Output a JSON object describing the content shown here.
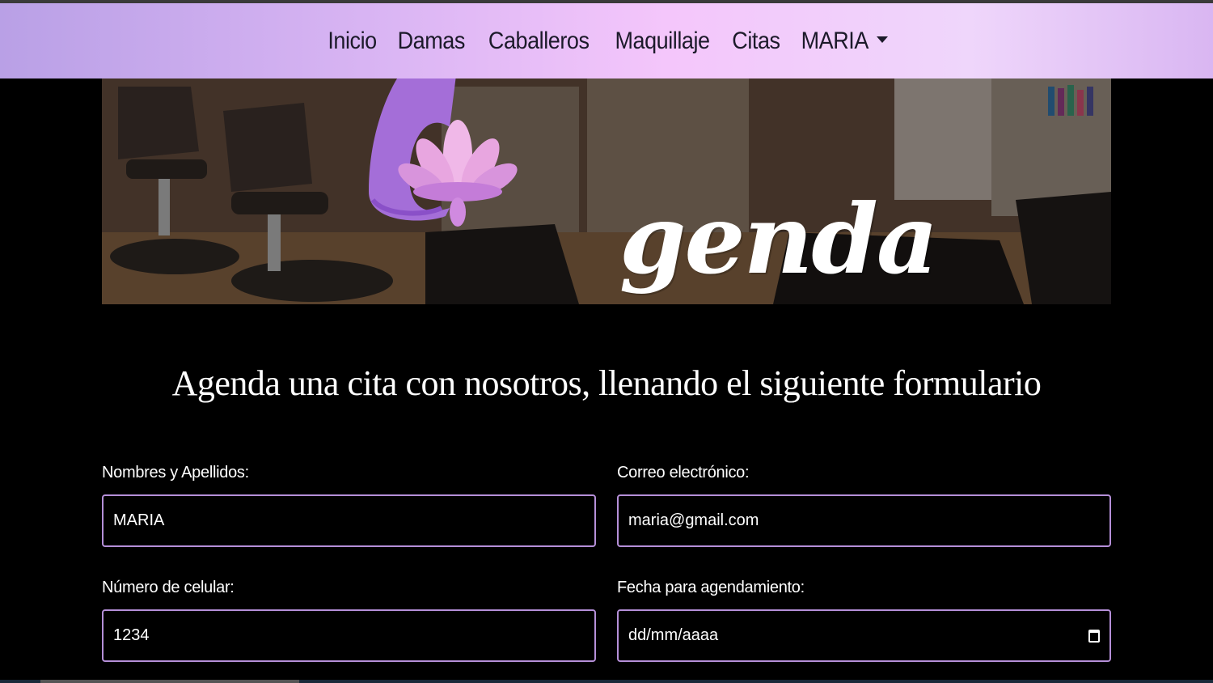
{
  "nav": {
    "items": [
      "Inicio",
      "Damas",
      "Caballeros",
      "Maquillaje",
      "Citas"
    ],
    "user_menu": "MARIA"
  },
  "banner": {
    "logo_text": "genda",
    "logo_initial": "A"
  },
  "heading": "Agenda una cita con nosotros, llenando el siguiente formulario",
  "form": {
    "name_label": "Nombres y Apellidos:",
    "name_value": "MARIA",
    "email_label": "Correo electrónico:",
    "email_value": "maria@gmail.com",
    "phone_label": "Número de celular:",
    "phone_value": "1234",
    "date_label": "Fecha para agendamiento:",
    "date_value": "dd/mm/aaaa"
  },
  "colors": {
    "accent": "#b58fd8",
    "background": "#000000"
  }
}
